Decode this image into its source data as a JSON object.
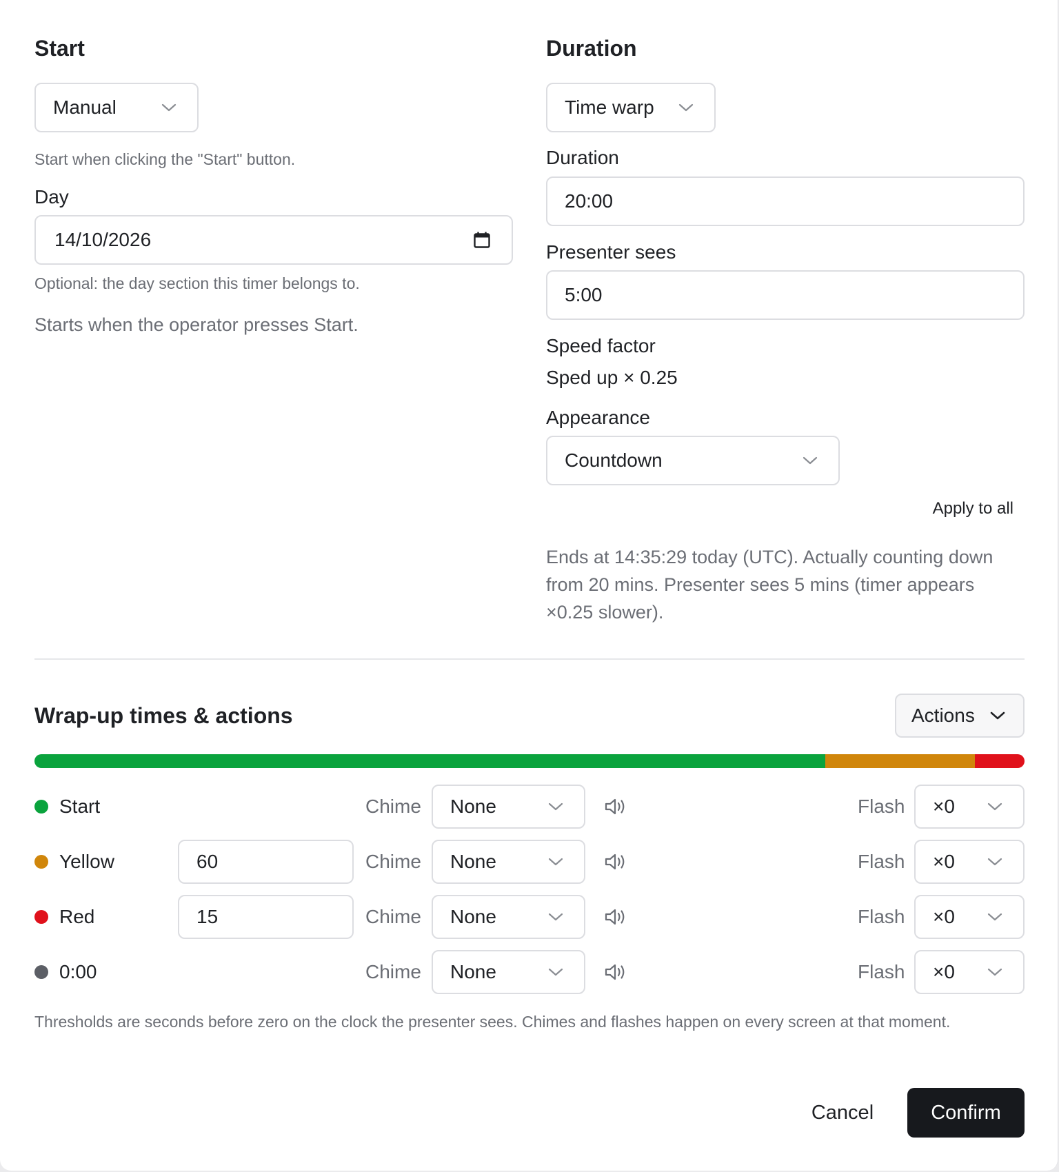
{
  "start": {
    "heading": "Start",
    "mode": "Manual",
    "help": "Start when clicking the \"Start\" button.",
    "day_label": "Day",
    "day_value": "14/10/2026",
    "day_help": "Optional: the day section this timer belongs to.",
    "summary": "Starts when the operator presses Start."
  },
  "duration": {
    "heading": "Duration",
    "mode": "Time warp",
    "duration_label": "Duration",
    "duration_value": "20:00",
    "presenter_label": "Presenter sees",
    "presenter_value": "5:00",
    "speed_label": "Speed factor",
    "speed_value": "Sped up × 0.25",
    "appearance_label": "Appearance",
    "appearance_value": "Countdown",
    "apply_all": "Apply to all",
    "summary": "Ends at 14:35:29 today (UTC). Actually counting down from 20 mins. Presenter sees 5 mins (timer appears ×0.25 slower)."
  },
  "wrapup": {
    "heading": "Wrap-up times & actions",
    "actions_label": "Actions",
    "bar": [
      {
        "color": "#0aa33d",
        "fraction": 0.799
      },
      {
        "color": "#d0860b",
        "fraction": 0.151
      },
      {
        "color": "#e0111b",
        "fraction": 0.05
      }
    ],
    "chime_label": "Chime",
    "flash_label": "Flash",
    "rows": [
      {
        "name": "Start",
        "color": "#0aa33d",
        "threshold": "",
        "chime": "None",
        "flash": "×0"
      },
      {
        "name": "Yellow",
        "color": "#d0860b",
        "threshold": "60",
        "chime": "None",
        "flash": "×0"
      },
      {
        "name": "Red",
        "color": "#e0111b",
        "threshold": "15",
        "chime": "None",
        "flash": "×0"
      },
      {
        "name": "0:00",
        "color": "#5c5f66",
        "threshold": "",
        "chime": "None",
        "flash": "×0"
      }
    ],
    "help": "Thresholds are seconds before zero on the clock the presenter sees. Chimes and flashes happen on every screen at that moment."
  },
  "footer": {
    "cancel": "Cancel",
    "confirm": "Confirm"
  }
}
